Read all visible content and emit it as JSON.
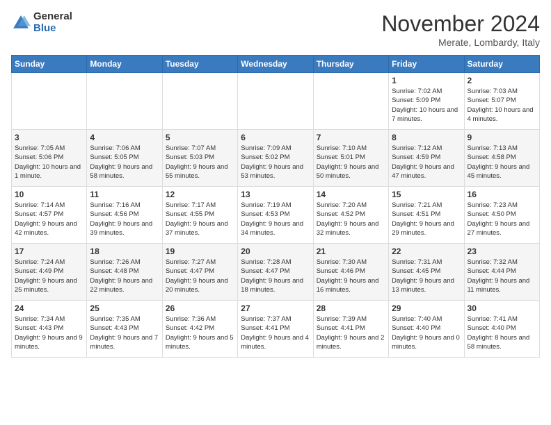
{
  "header": {
    "logo_general": "General",
    "logo_blue": "Blue",
    "month_title": "November 2024",
    "location": "Merate, Lombardy, Italy"
  },
  "weekdays": [
    "Sunday",
    "Monday",
    "Tuesday",
    "Wednesday",
    "Thursday",
    "Friday",
    "Saturday"
  ],
  "weeks": [
    [
      {
        "day": "",
        "info": ""
      },
      {
        "day": "",
        "info": ""
      },
      {
        "day": "",
        "info": ""
      },
      {
        "day": "",
        "info": ""
      },
      {
        "day": "",
        "info": ""
      },
      {
        "day": "1",
        "info": "Sunrise: 7:02 AM\nSunset: 5:09 PM\nDaylight: 10 hours and 7 minutes."
      },
      {
        "day": "2",
        "info": "Sunrise: 7:03 AM\nSunset: 5:07 PM\nDaylight: 10 hours and 4 minutes."
      }
    ],
    [
      {
        "day": "3",
        "info": "Sunrise: 7:05 AM\nSunset: 5:06 PM\nDaylight: 10 hours and 1 minute."
      },
      {
        "day": "4",
        "info": "Sunrise: 7:06 AM\nSunset: 5:05 PM\nDaylight: 9 hours and 58 minutes."
      },
      {
        "day": "5",
        "info": "Sunrise: 7:07 AM\nSunset: 5:03 PM\nDaylight: 9 hours and 55 minutes."
      },
      {
        "day": "6",
        "info": "Sunrise: 7:09 AM\nSunset: 5:02 PM\nDaylight: 9 hours and 53 minutes."
      },
      {
        "day": "7",
        "info": "Sunrise: 7:10 AM\nSunset: 5:01 PM\nDaylight: 9 hours and 50 minutes."
      },
      {
        "day": "8",
        "info": "Sunrise: 7:12 AM\nSunset: 4:59 PM\nDaylight: 9 hours and 47 minutes."
      },
      {
        "day": "9",
        "info": "Sunrise: 7:13 AM\nSunset: 4:58 PM\nDaylight: 9 hours and 45 minutes."
      }
    ],
    [
      {
        "day": "10",
        "info": "Sunrise: 7:14 AM\nSunset: 4:57 PM\nDaylight: 9 hours and 42 minutes."
      },
      {
        "day": "11",
        "info": "Sunrise: 7:16 AM\nSunset: 4:56 PM\nDaylight: 9 hours and 39 minutes."
      },
      {
        "day": "12",
        "info": "Sunrise: 7:17 AM\nSunset: 4:55 PM\nDaylight: 9 hours and 37 minutes."
      },
      {
        "day": "13",
        "info": "Sunrise: 7:19 AM\nSunset: 4:53 PM\nDaylight: 9 hours and 34 minutes."
      },
      {
        "day": "14",
        "info": "Sunrise: 7:20 AM\nSunset: 4:52 PM\nDaylight: 9 hours and 32 minutes."
      },
      {
        "day": "15",
        "info": "Sunrise: 7:21 AM\nSunset: 4:51 PM\nDaylight: 9 hours and 29 minutes."
      },
      {
        "day": "16",
        "info": "Sunrise: 7:23 AM\nSunset: 4:50 PM\nDaylight: 9 hours and 27 minutes."
      }
    ],
    [
      {
        "day": "17",
        "info": "Sunrise: 7:24 AM\nSunset: 4:49 PM\nDaylight: 9 hours and 25 minutes."
      },
      {
        "day": "18",
        "info": "Sunrise: 7:26 AM\nSunset: 4:48 PM\nDaylight: 9 hours and 22 minutes."
      },
      {
        "day": "19",
        "info": "Sunrise: 7:27 AM\nSunset: 4:47 PM\nDaylight: 9 hours and 20 minutes."
      },
      {
        "day": "20",
        "info": "Sunrise: 7:28 AM\nSunset: 4:47 PM\nDaylight: 9 hours and 18 minutes."
      },
      {
        "day": "21",
        "info": "Sunrise: 7:30 AM\nSunset: 4:46 PM\nDaylight: 9 hours and 16 minutes."
      },
      {
        "day": "22",
        "info": "Sunrise: 7:31 AM\nSunset: 4:45 PM\nDaylight: 9 hours and 13 minutes."
      },
      {
        "day": "23",
        "info": "Sunrise: 7:32 AM\nSunset: 4:44 PM\nDaylight: 9 hours and 11 minutes."
      }
    ],
    [
      {
        "day": "24",
        "info": "Sunrise: 7:34 AM\nSunset: 4:43 PM\nDaylight: 9 hours and 9 minutes."
      },
      {
        "day": "25",
        "info": "Sunrise: 7:35 AM\nSunset: 4:43 PM\nDaylight: 9 hours and 7 minutes."
      },
      {
        "day": "26",
        "info": "Sunrise: 7:36 AM\nSunset: 4:42 PM\nDaylight: 9 hours and 5 minutes."
      },
      {
        "day": "27",
        "info": "Sunrise: 7:37 AM\nSunset: 4:41 PM\nDaylight: 9 hours and 4 minutes."
      },
      {
        "day": "28",
        "info": "Sunrise: 7:39 AM\nSunset: 4:41 PM\nDaylight: 9 hours and 2 minutes."
      },
      {
        "day": "29",
        "info": "Sunrise: 7:40 AM\nSunset: 4:40 PM\nDaylight: 9 hours and 0 minutes."
      },
      {
        "day": "30",
        "info": "Sunrise: 7:41 AM\nSunset: 4:40 PM\nDaylight: 8 hours and 58 minutes."
      }
    ]
  ]
}
